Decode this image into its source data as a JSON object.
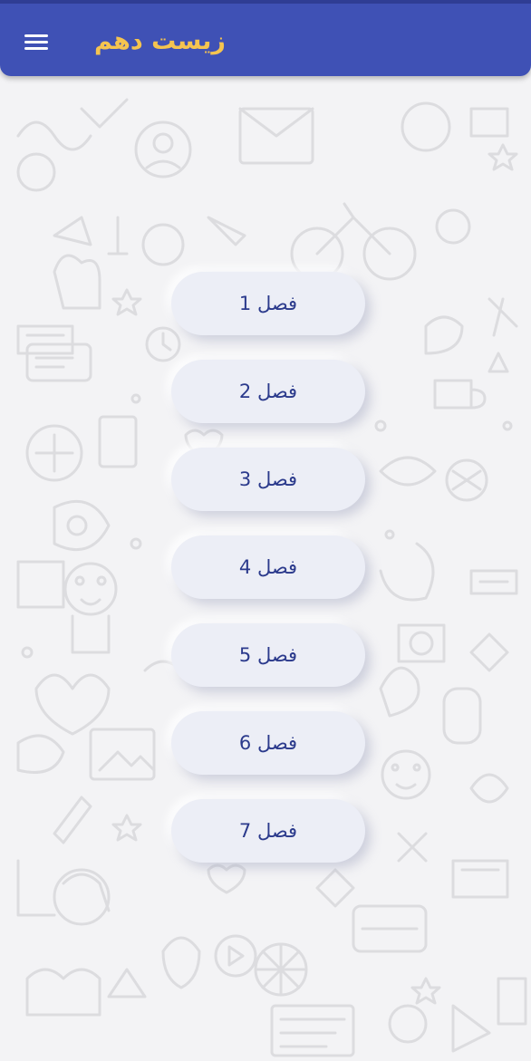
{
  "appbar": {
    "title": "زیست دهم",
    "menu_icon": "hamburger-menu-icon",
    "color": "#3f51b5",
    "title_color": "#f5c44f"
  },
  "chapters": [
    {
      "label": "فصل 1"
    },
    {
      "label": "فصل 2"
    },
    {
      "label": "فصل 3"
    },
    {
      "label": "فصل 4"
    },
    {
      "label": "فصل 5"
    },
    {
      "label": "فصل 6"
    },
    {
      "label": "فصل 7"
    }
  ],
  "background": {
    "color": "#f3f3f5",
    "pattern": "doodle-wallpaper"
  }
}
